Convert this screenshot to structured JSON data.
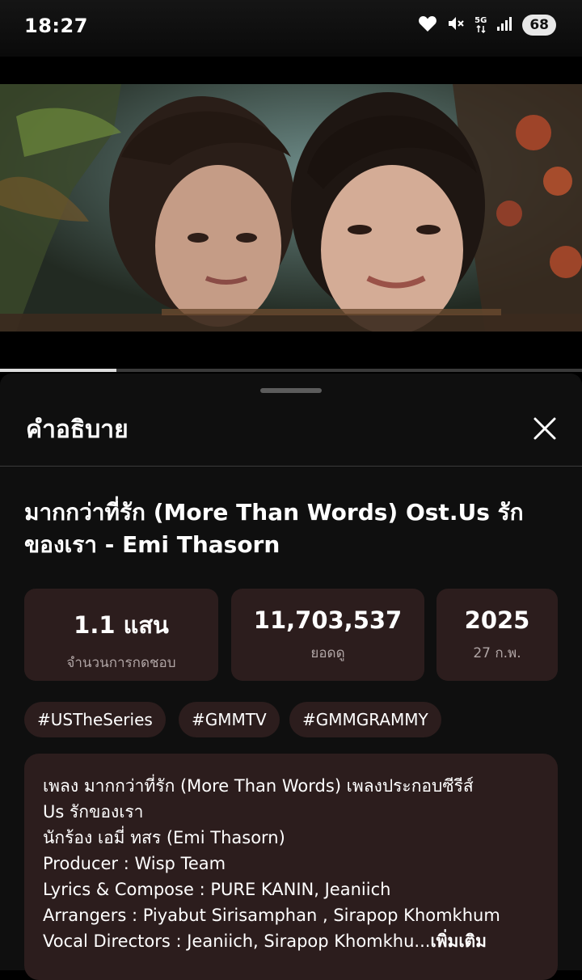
{
  "status_bar": {
    "time": "18:27",
    "network": "5G",
    "battery": "68",
    "icons": [
      "heart-icon",
      "mute-icon",
      "signal-icon"
    ]
  },
  "video": {
    "progress": 0.2
  },
  "sheet": {
    "title": "คำอธิบาย",
    "video_title": "มากกว่าที่รัก (More Than Words) Ost.Us รักของเรา - Emi Thasorn",
    "stats": [
      {
        "value": "1.1 แสน",
        "label": "จำนวนการกดชอบ"
      },
      {
        "value": "11,703,537",
        "label": "ยอดดู"
      },
      {
        "value": "2025",
        "label": "27 ก.พ."
      }
    ],
    "tags": [
      "#USTheSeries",
      "#GMMTV",
      "#GMMGRAMMY"
    ],
    "description_lines": [
      "เพลง มากกว่าที่รัก (More Than Words) เพลงประกอบซีรีส์",
      "Us รักของเรา",
      "นักร้อง เอมี่ ทสร (Emi Thasorn)",
      "Producer : Wisp Team",
      "Lyrics & Compose : PURE KANIN, Jeaniich",
      "Arrangers : Piyabut Sirisamphan , Sirapop Khomkhum",
      "Vocal Directors : Jeaniich, Sirapop Khomkhu..."
    ],
    "more_label": "เพิ่มเติม"
  },
  "colors": {
    "sheet_bg": "#0f0f0f",
    "card_bg": "#2c1d1d"
  }
}
